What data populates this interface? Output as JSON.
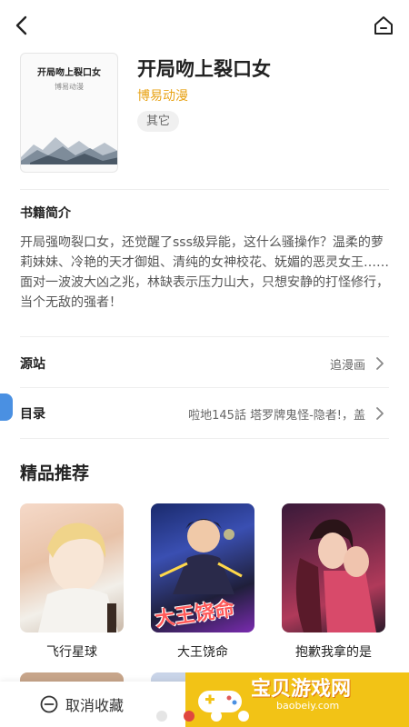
{
  "book": {
    "title": "开局吻上裂口女",
    "author": "博易动漫",
    "tag": "其它",
    "cover_title": "开局吻上裂口女",
    "cover_author": "博易动漫"
  },
  "intro": {
    "label": "书籍简介",
    "text": "开局强吻裂口女，还觉醒了sss级异能，这什么骚操作？温柔的萝莉妹妹、冷艳的天才御姐、清纯的女神校花、妩媚的恶灵女王……面对一波波大凶之兆，林缺表示压力山大，只想安静的打怪修行，当个无敌的强者！"
  },
  "source": {
    "label": "源站",
    "value": "追漫画"
  },
  "catalog": {
    "label": "目录",
    "value": "啦地145話 塔罗牌鬼怪-隐者!，盖"
  },
  "recommend": {
    "title": "精品推荐",
    "items": [
      {
        "label": "飞行星球"
      },
      {
        "label": "大王饶命",
        "cover_text": "大王饶命"
      },
      {
        "label": "抱歉我拿的是"
      }
    ]
  },
  "bottom": {
    "cancel_label": "取消收藏"
  },
  "watermark": {
    "cn": "宝贝游戏网",
    "url": "baobeiy.com"
  },
  "icons": {
    "back": "chevron-left-icon",
    "home": "home-icon",
    "chevron": "chevron-right-icon",
    "cancel": "minus-circle-icon"
  },
  "colors": {
    "author": "#e8a317",
    "side_tab": "#4a90e2",
    "watermark_bg": "#f2c316"
  }
}
